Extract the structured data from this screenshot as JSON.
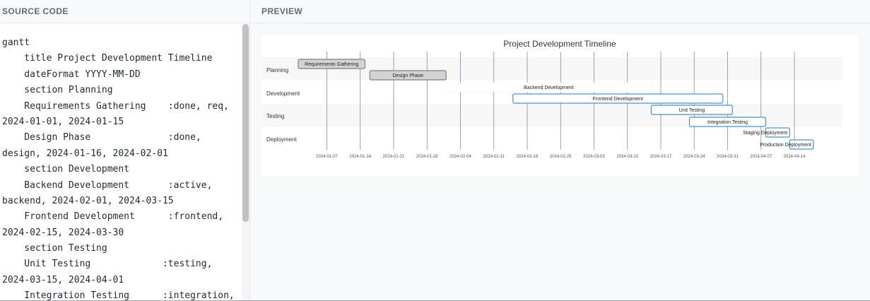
{
  "panels": {
    "source_label": "SOURCE CODE",
    "preview_label": "PREVIEW"
  },
  "code_lines": [
    "gantt",
    "    title Project Development Timeline",
    "    dateFormat YYYY-MM-DD",
    "    section Planning",
    "    Requirements Gathering    :done, req,",
    "2024-01-01, 2024-01-15",
    "    Design Phase              :done,",
    "design, 2024-01-16, 2024-02-01",
    "    section Development",
    "    Backend Development       :active,",
    "backend, 2024-02-01, 2024-03-15",
    "    Frontend Development      :frontend,",
    "2024-02-15, 2024-03-30",
    "    section Testing",
    "    Unit Testing             :testing,",
    "2024-03-15, 2024-04-01",
    "    Integration Testing      :integration,"
  ],
  "gantt": {
    "title": "Project Development Timeline",
    "sections": [
      "Planning",
      "Development",
      "Testing",
      "Deployment"
    ],
    "tasks": [
      {
        "name": "Requirements Gathering",
        "section": "Planning",
        "status": "done",
        "start": "2024-01-01",
        "end": "2024-01-15"
      },
      {
        "name": "Design Phase",
        "section": "Planning",
        "status": "done",
        "start": "2024-01-16",
        "end": "2024-02-01"
      },
      {
        "name": "Backend Development",
        "section": "Development",
        "status": "active",
        "start": "2024-02-01",
        "end": "2024-03-15"
      },
      {
        "name": "Frontend Development",
        "section": "Development",
        "status": "normal",
        "start": "2024-02-15",
        "end": "2024-03-30"
      },
      {
        "name": "Unit Testing",
        "section": "Testing",
        "status": "normal",
        "start": "2024-03-15",
        "end": "2024-04-01"
      },
      {
        "name": "Integration Testing",
        "section": "Testing",
        "status": "normal",
        "start": "2024-03-23",
        "end": "2024-04-08"
      },
      {
        "name": "Staging Deployment",
        "section": "Deployment",
        "status": "normal",
        "start": "2024-04-08",
        "end": "2024-04-13"
      },
      {
        "name": "Production Deployment",
        "section": "Deployment",
        "status": "normal",
        "start": "2024-04-13",
        "end": "2024-04-18"
      }
    ],
    "ticks": [
      "2024-01-07",
      "2024-01-14",
      "2024-01-21",
      "2024-01-28",
      "2024-02-04",
      "2024-02-11",
      "2024-02-18",
      "2024-02-25",
      "2024-03-03",
      "2024-03-10",
      "2024-03-17",
      "2024-03-24",
      "2024-03-31",
      "2024-04-07",
      "2024-04-14"
    ],
    "colors": {
      "done_fill": "#d3d3d3",
      "done_stroke": "#808080",
      "task_fill": "#ffffff",
      "task_stroke": "#4a90d9",
      "grid": "#6b6b8a",
      "section_band": "#f7f7f7"
    }
  }
}
